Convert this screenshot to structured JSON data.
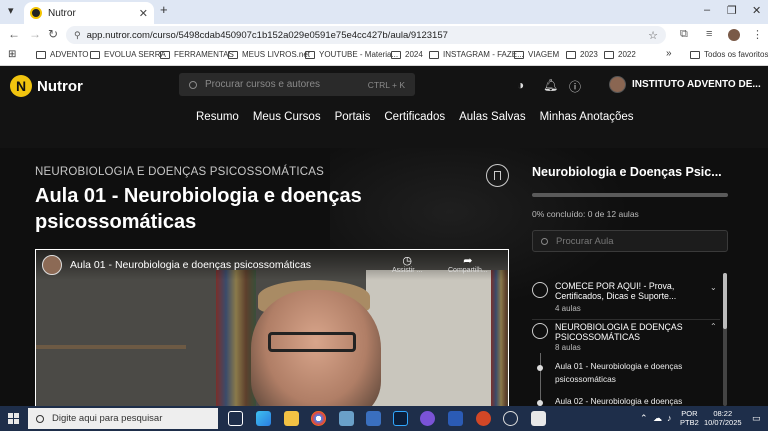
{
  "browser": {
    "tab_title": "Nutror",
    "tab_close": "✕",
    "new_tab": "+",
    "url": "app.nutror.com/curso/5498cdab450907c1b152a029e0591e75e4cc427b/aula/9123157",
    "bookmarks": [
      "ADVENTO",
      "EVOLUA SERRA",
      "FERRAMENTAS",
      "MEUS LIVROS.net",
      "YOUTUBE - Materia...",
      "2024",
      "INSTAGRAM - FAZE...",
      "VIAGEM",
      "2023",
      "2022"
    ],
    "bookmarks_more": "»",
    "all_bookmarks": "Todos os favoritos"
  },
  "app": {
    "logo_letter": "N",
    "logo_text": "Nutror",
    "search_placeholder": "Procurar cursos e autores",
    "search_shortcut": "CTRL + K",
    "user_name": "INSTITUTO ADVENTO DE...",
    "menu": [
      "Resumo",
      "Meus Cursos",
      "Portais",
      "Certificados",
      "Aulas Salvas",
      "Minhas Anotações"
    ]
  },
  "lesson": {
    "course_label": "NEUROBIOLOGIA E DOENÇAS PSICOSSOMÁTICAS",
    "title": "Aula 01 - Neurobiologia e doenças psicossomáticas",
    "video_title": "Aula 01 - Neurobiologia e doenças psicossomáticas",
    "video_watch_later": "Assistir ...",
    "video_share": "Compartilh..."
  },
  "sidebar": {
    "title": "Neurobiologia e Doenças Psic...",
    "progress_fraction": 0,
    "progress_text": "0% concluído: 0 de 12 aulas",
    "search_placeholder": "Procurar Aula",
    "modules": [
      {
        "title": "COMECE POR AQUI! - Prova, Certificados, Dicas e Suporte...",
        "count": "4 aulas",
        "expanded": false
      },
      {
        "title": "NEUROBIOLOGIA E DOENÇAS PSICOSSOMÁTICAS",
        "count": "8 aulas",
        "expanded": true
      }
    ],
    "lessons": [
      "Aula 01 - Neurobiologia e doenças psicossomáticas",
      "Aula 02 - Neurobiologia e doenças"
    ]
  },
  "taskbar": {
    "search_placeholder": "Digite aqui para pesquisar",
    "lang": "POR",
    "layout": "PTB2",
    "time": "08:22",
    "date": "10/07/2025"
  }
}
